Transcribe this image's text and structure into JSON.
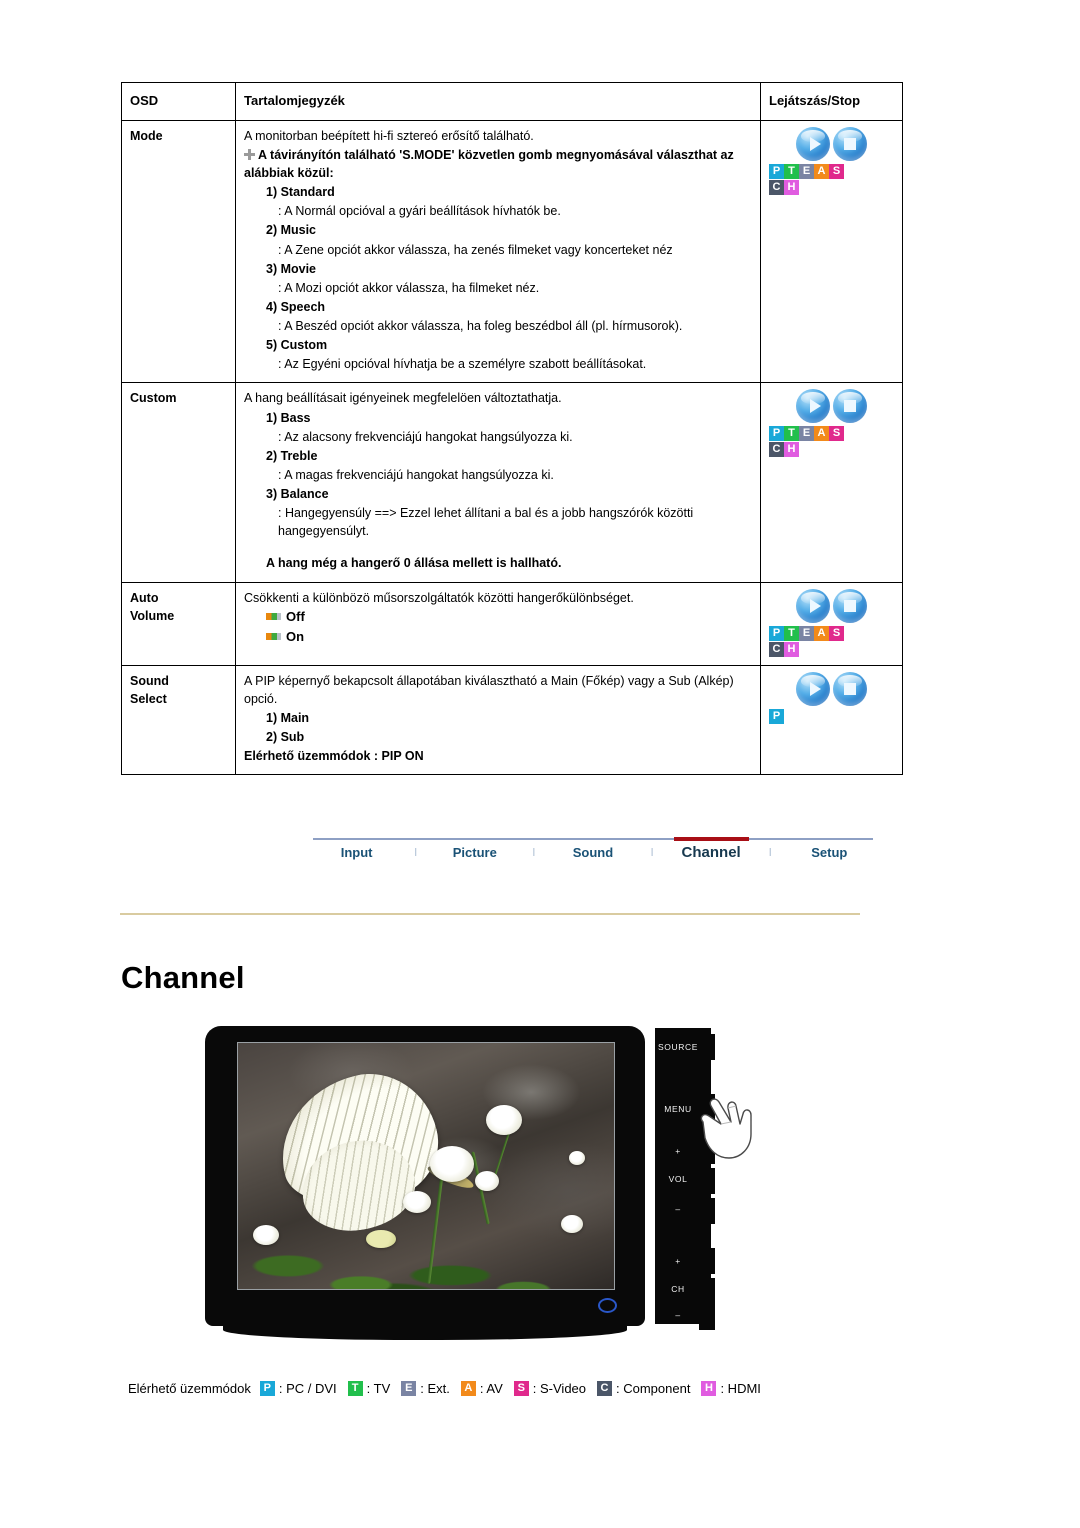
{
  "table": {
    "headers": {
      "osd": "OSD",
      "contents": "Tartalomjegyzék",
      "play": "Lejátszás/Stop"
    },
    "rows": [
      {
        "name": "Mode",
        "lines": [
          {
            "style": "normal",
            "text": "A monitorban beépített hi-fi sztereó erősítő található."
          },
          {
            "style": "bold-plus",
            "text": "A távirányítón található 'S.MODE' közvetlen gomb megnyomásával választhat az alábbiak közül:"
          },
          {
            "style": "lvl1",
            "text": "1) Standard"
          },
          {
            "style": "lvl2",
            "text": ": A Normál opcióval a gyári beállítások hívhatók be."
          },
          {
            "style": "lvl1",
            "text": "2) Music"
          },
          {
            "style": "lvl2",
            "text": ": A Zene opciót akkor válassza, ha zenés filmeket vagy koncerteket néz"
          },
          {
            "style": "lvl1",
            "text": "3) Movie"
          },
          {
            "style": "lvl2",
            "text": ": A Mozi opciót akkor válassza, ha filmeket néz."
          },
          {
            "style": "lvl1",
            "text": "4) Speech"
          },
          {
            "style": "lvl2",
            "text": ": A Beszéd opciót akkor válassza, ha foleg beszédbol áll (pl. hírmusorok)."
          },
          {
            "style": "lvl1",
            "text": "5) Custom"
          },
          {
            "style": "lvl2",
            "text": ": Az Egyéni opcióval hívhatja be a személyre szabott beállításokat."
          }
        ],
        "badges_row1": [
          "P",
          "T",
          "E",
          "A",
          "S"
        ],
        "badges_row2": [
          "C",
          "H"
        ]
      },
      {
        "name": "Custom",
        "lines": [
          {
            "style": "normal",
            "text": "A hang beállításait igényeinek megfelelöen változtathatja."
          },
          {
            "style": "lvl1",
            "text": "1) Bass"
          },
          {
            "style": "lvl2",
            "text": ": Az alacsony frekvenciájú hangokat hangsúlyozza ki."
          },
          {
            "style": "lvl1",
            "text": "2) Treble"
          },
          {
            "style": "lvl2",
            "text": ": A magas frekvenciájú hangokat hangsúlyozza ki."
          },
          {
            "style": "lvl1",
            "text": "3) Balance"
          },
          {
            "style": "lvl2",
            "text": ": Hangegyensúly ==> Ezzel lehet állítani a bal és a jobb hangszórók közötti hangegyensúlyt."
          },
          {
            "style": "spacer",
            "text": ""
          },
          {
            "style": "bold-indent",
            "text": "A hang még a hangerő 0 állása mellett is hallható."
          }
        ],
        "badges_row1": [
          "P",
          "T",
          "E",
          "A",
          "S"
        ],
        "badges_row2": [
          "C",
          "H"
        ]
      },
      {
        "name": "Auto\nVolume",
        "lines": [
          {
            "style": "normal",
            "text": "Csökkenti a különbözö műsorszolgáltatók közötti hangerőkülönbséget."
          },
          {
            "style": "bullet",
            "text": "Off"
          },
          {
            "style": "bullet",
            "text": "On"
          }
        ],
        "badges_row1": [
          "P",
          "T",
          "E",
          "A",
          "S"
        ],
        "badges_row2": [
          "C",
          "H"
        ]
      },
      {
        "name": "Sound\nSelect",
        "lines": [
          {
            "style": "normal",
            "text": "A PIP képernyő bekapcsolt állapotában kiválasztható a Main (Főkép) vagy a Sub (Alkép) opció."
          },
          {
            "style": "lvl1",
            "text": "1) Main"
          },
          {
            "style": "lvl1",
            "text": "2) Sub"
          },
          {
            "style": "bold",
            "text": "Elérhető üzemmódok : PIP ON"
          }
        ],
        "badges_row1": [
          "P"
        ],
        "badges_row2": []
      }
    ]
  },
  "nav": {
    "items": [
      {
        "label": "Input",
        "active": false
      },
      {
        "label": "Picture",
        "active": false
      },
      {
        "label": "Sound",
        "active": false
      },
      {
        "label": "Channel",
        "active": true
      },
      {
        "label": "Setup",
        "active": false
      }
    ],
    "separator": "l",
    "active_color": "#a80f16"
  },
  "page": {
    "heading": "Channel"
  },
  "monitor": {
    "controls": [
      "SOURCE",
      "MENU",
      "+",
      "VOL",
      "–",
      "+",
      "CH",
      "–"
    ],
    "screen_content": "butterfly-on-white-flowers-photo"
  },
  "legend": {
    "label": "Elérhető üzemmódok",
    "items": [
      {
        "badge": "P",
        "text": ": PC / DVI",
        "color": "#19a8d8"
      },
      {
        "badge": "T",
        "text": ": TV",
        "color": "#21bf4c"
      },
      {
        "badge": "E",
        "text": ": Ext.",
        "color": "#7a84a3"
      },
      {
        "badge": "A",
        "text": ": AV",
        "color": "#f28a1b"
      },
      {
        "badge": "S",
        "text": ": S-Video",
        "color": "#e0298c"
      },
      {
        "badge": "C",
        "text": ": Component",
        "color": "#4b5668"
      },
      {
        "badge": "H",
        "text": ": HDMI",
        "color": "#e05ce0"
      }
    ]
  },
  "badge_colors": {
    "P": "#19a8d8",
    "T": "#21bf4c",
    "E": "#7a84a3",
    "A": "#f28a1b",
    "S": "#e0298c",
    "C": "#4b5668",
    "H": "#e05ce0"
  }
}
